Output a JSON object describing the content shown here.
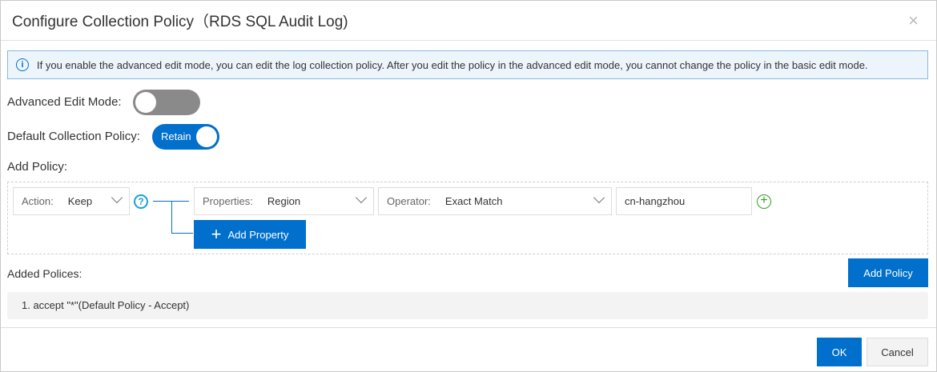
{
  "dialog": {
    "title": "Configure Collection Policy（RDS SQL Audit Log)",
    "close_icon": "×"
  },
  "notice": "If you enable the advanced edit mode, you can edit the log collection policy. After you edit the policy in the advanced edit mode, you cannot change the policy in the basic edit mode.",
  "advanced": {
    "label": "Advanced Edit Mode:",
    "enabled": false
  },
  "default_policy": {
    "label": "Default Collection Policy:",
    "value": "Retain",
    "enabled": true
  },
  "add_policy": {
    "label": "Add Policy:",
    "action_key": "Action:",
    "action_value": "Keep",
    "help": "?",
    "prop_key": "Properties:",
    "prop_value": "Region",
    "op_key": "Operator:",
    "op_value": "Exact Match",
    "value": "cn-hangzhou",
    "add_property": "Add Property",
    "add_policy_button": "Add Policy"
  },
  "added": {
    "label": "Added Polices:",
    "items": [
      "1.  accept \"*\"(Default Policy - Accept)"
    ]
  },
  "footer": {
    "ok": "OK",
    "cancel": "Cancel"
  },
  "colors": {
    "primary": "#0070cc",
    "green": "#2ea121"
  }
}
